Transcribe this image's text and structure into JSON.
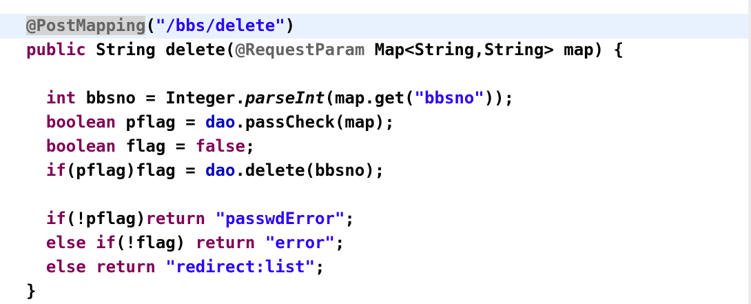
{
  "editor": {
    "language": "java",
    "colors": {
      "annotation": "#646464",
      "keyword": "#7f0055",
      "string": "#2a00ff",
      "field": "#0000c0",
      "plain": "#000000",
      "current_line": "#e8f2fe"
    },
    "lines": [
      [
        {
          "t": "@PostMapping",
          "c": "annotation",
          "hl": true
        },
        {
          "t": "(",
          "c": "plain"
        },
        {
          "t": "\"/bbs/delete\"",
          "c": "string"
        },
        {
          "t": ")",
          "c": "plain"
        }
      ],
      [
        {
          "t": "public",
          "c": "keyword"
        },
        {
          "t": " String delete(",
          "c": "plain"
        },
        {
          "t": "@RequestParam",
          "c": "annotation"
        },
        {
          "t": " Map<String,String> map) {",
          "c": "plain"
        }
      ],
      [],
      [
        {
          "t": "  ",
          "c": "plain"
        },
        {
          "t": "int",
          "c": "keyword"
        },
        {
          "t": " bbsno = Integer.",
          "c": "plain"
        },
        {
          "t": "parseInt",
          "c": "static"
        },
        {
          "t": "(map.get(",
          "c": "plain"
        },
        {
          "t": "\"bbsno\"",
          "c": "string"
        },
        {
          "t": "));",
          "c": "plain"
        }
      ],
      [
        {
          "t": "  ",
          "c": "plain"
        },
        {
          "t": "boolean",
          "c": "keyword"
        },
        {
          "t": " pflag = ",
          "c": "plain"
        },
        {
          "t": "dao",
          "c": "field"
        },
        {
          "t": ".passCheck(map);",
          "c": "plain"
        }
      ],
      [
        {
          "t": "  ",
          "c": "plain"
        },
        {
          "t": "boolean",
          "c": "keyword"
        },
        {
          "t": " flag = ",
          "c": "plain"
        },
        {
          "t": "false",
          "c": "keyword"
        },
        {
          "t": ";",
          "c": "plain"
        }
      ],
      [
        {
          "t": "  ",
          "c": "plain"
        },
        {
          "t": "if",
          "c": "keyword"
        },
        {
          "t": "(pflag)flag = ",
          "c": "plain"
        },
        {
          "t": "dao",
          "c": "field"
        },
        {
          "t": ".delete(bbsno);",
          "c": "plain"
        }
      ],
      [],
      [
        {
          "t": "  ",
          "c": "plain"
        },
        {
          "t": "if",
          "c": "keyword"
        },
        {
          "t": "(!pflag)",
          "c": "plain"
        },
        {
          "t": "return",
          "c": "keyword"
        },
        {
          "t": " ",
          "c": "plain"
        },
        {
          "t": "\"passwdError\"",
          "c": "string"
        },
        {
          "t": ";",
          "c": "plain"
        }
      ],
      [
        {
          "t": "  ",
          "c": "plain"
        },
        {
          "t": "else",
          "c": "keyword"
        },
        {
          "t": " ",
          "c": "plain"
        },
        {
          "t": "if",
          "c": "keyword"
        },
        {
          "t": "(!flag) ",
          "c": "plain"
        },
        {
          "t": "return",
          "c": "keyword"
        },
        {
          "t": " ",
          "c": "plain"
        },
        {
          "t": "\"error\"",
          "c": "string"
        },
        {
          "t": ";",
          "c": "plain"
        }
      ],
      [
        {
          "t": "  ",
          "c": "plain"
        },
        {
          "t": "else",
          "c": "keyword"
        },
        {
          "t": " ",
          "c": "plain"
        },
        {
          "t": "return",
          "c": "keyword"
        },
        {
          "t": " ",
          "c": "plain"
        },
        {
          "t": "\"redirect:list\"",
          "c": "string"
        },
        {
          "t": ";",
          "c": "plain"
        }
      ],
      [
        {
          "t": "}",
          "c": "plain"
        }
      ]
    ]
  }
}
